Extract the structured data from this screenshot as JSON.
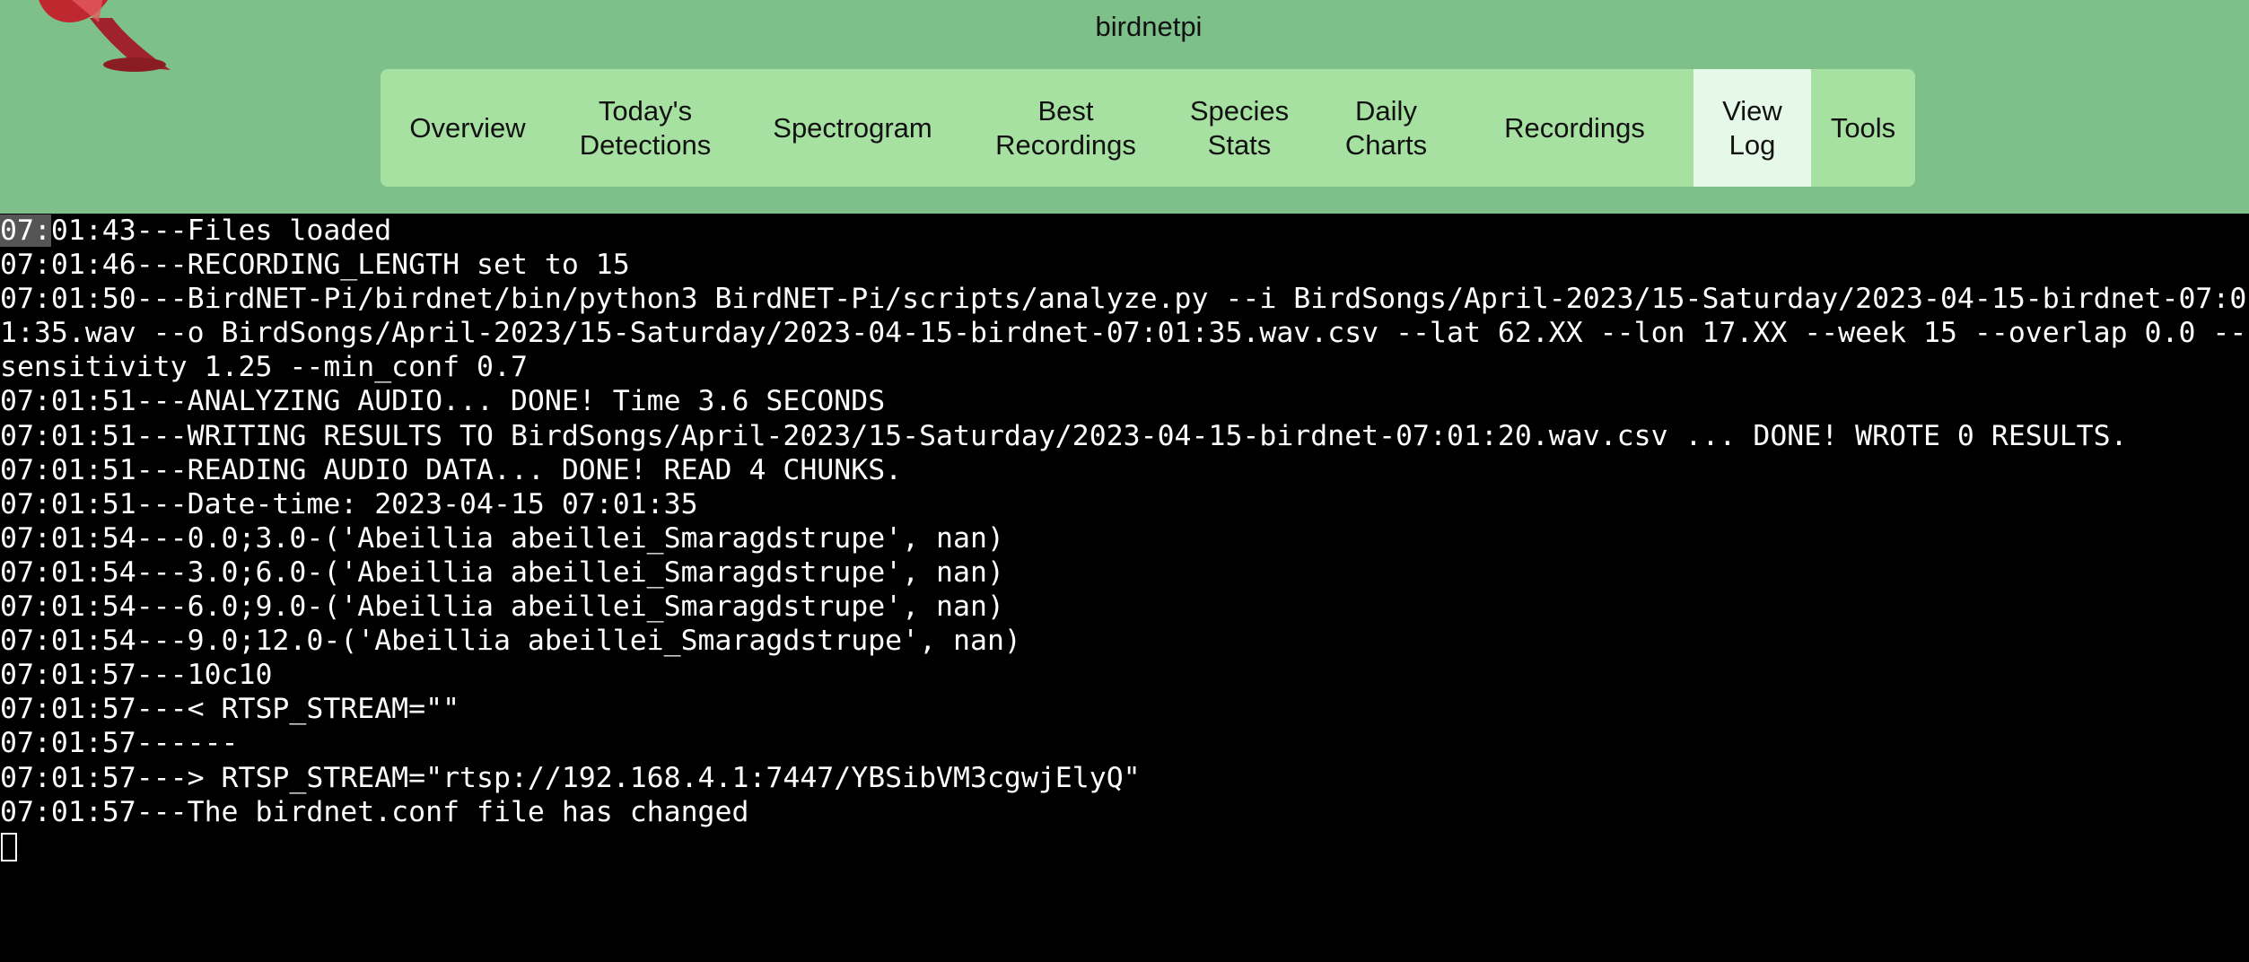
{
  "header": {
    "site_title": "birdnetpi"
  },
  "nav": {
    "items": [
      {
        "label": "Overview"
      },
      {
        "label": "Today's\nDetections"
      },
      {
        "label": "Spectrogram"
      },
      {
        "label": "Best\nRecordings"
      },
      {
        "label": "Species\nStats"
      },
      {
        "label": "Daily\nCharts"
      },
      {
        "label": "Recordings"
      },
      {
        "label": "View\nLog",
        "active": true
      },
      {
        "label": "Tools"
      }
    ]
  },
  "log": {
    "first_prefix": "07:",
    "first_rest": "01:43---Files loaded",
    "lines": [
      "07:01:46---RECORDING_LENGTH set to 15",
      "07:01:50---BirdNET-Pi/birdnet/bin/python3 BirdNET-Pi/scripts/analyze.py --i BirdSongs/April-2023/15-Saturday/2023-04-15-birdnet-07:0",
      "1:35.wav --o BirdSongs/April-2023/15-Saturday/2023-04-15-birdnet-07:01:35.wav.csv --lat 62.XX --lon 17.XX --week 15 --overlap 0.0 --",
      "sensitivity 1.25 --min_conf 0.7",
      "07:01:51---ANALYZING AUDIO... DONE! Time 3.6 SECONDS",
      "07:01:51---WRITING RESULTS TO BirdSongs/April-2023/15-Saturday/2023-04-15-birdnet-07:01:20.wav.csv ... DONE! WROTE 0 RESULTS.",
      "07:01:51---READING AUDIO DATA... DONE! READ 4 CHUNKS.",
      "07:01:51---Date-time: 2023-04-15 07:01:35",
      "07:01:54---0.0;3.0-('Abeillia abeillei_Smaragdstrupe', nan)",
      "07:01:54---3.0;6.0-('Abeillia abeillei_Smaragdstrupe', nan)",
      "07:01:54---6.0;9.0-('Abeillia abeillei_Smaragdstrupe', nan)",
      "07:01:54---9.0;12.0-('Abeillia abeillei_Smaragdstrupe', nan)",
      "07:01:57---10c10",
      "07:01:57---< RTSP_STREAM=\"\"",
      "07:01:57------",
      "07:01:57---> RTSP_STREAM=\"rtsp://192.168.4.1:7447/YBSibVM3cgwjElyQ\"",
      "07:01:57---The birdnet.conf file has changed"
    ]
  },
  "colors": {
    "header_bg": "#7dc08a",
    "nav_bg": "#a6e1a1",
    "nav_active_bg": "#e6f8e8",
    "terminal_bg": "#000000",
    "terminal_fg": "#ffffff",
    "logo_red": "#c0282f"
  }
}
